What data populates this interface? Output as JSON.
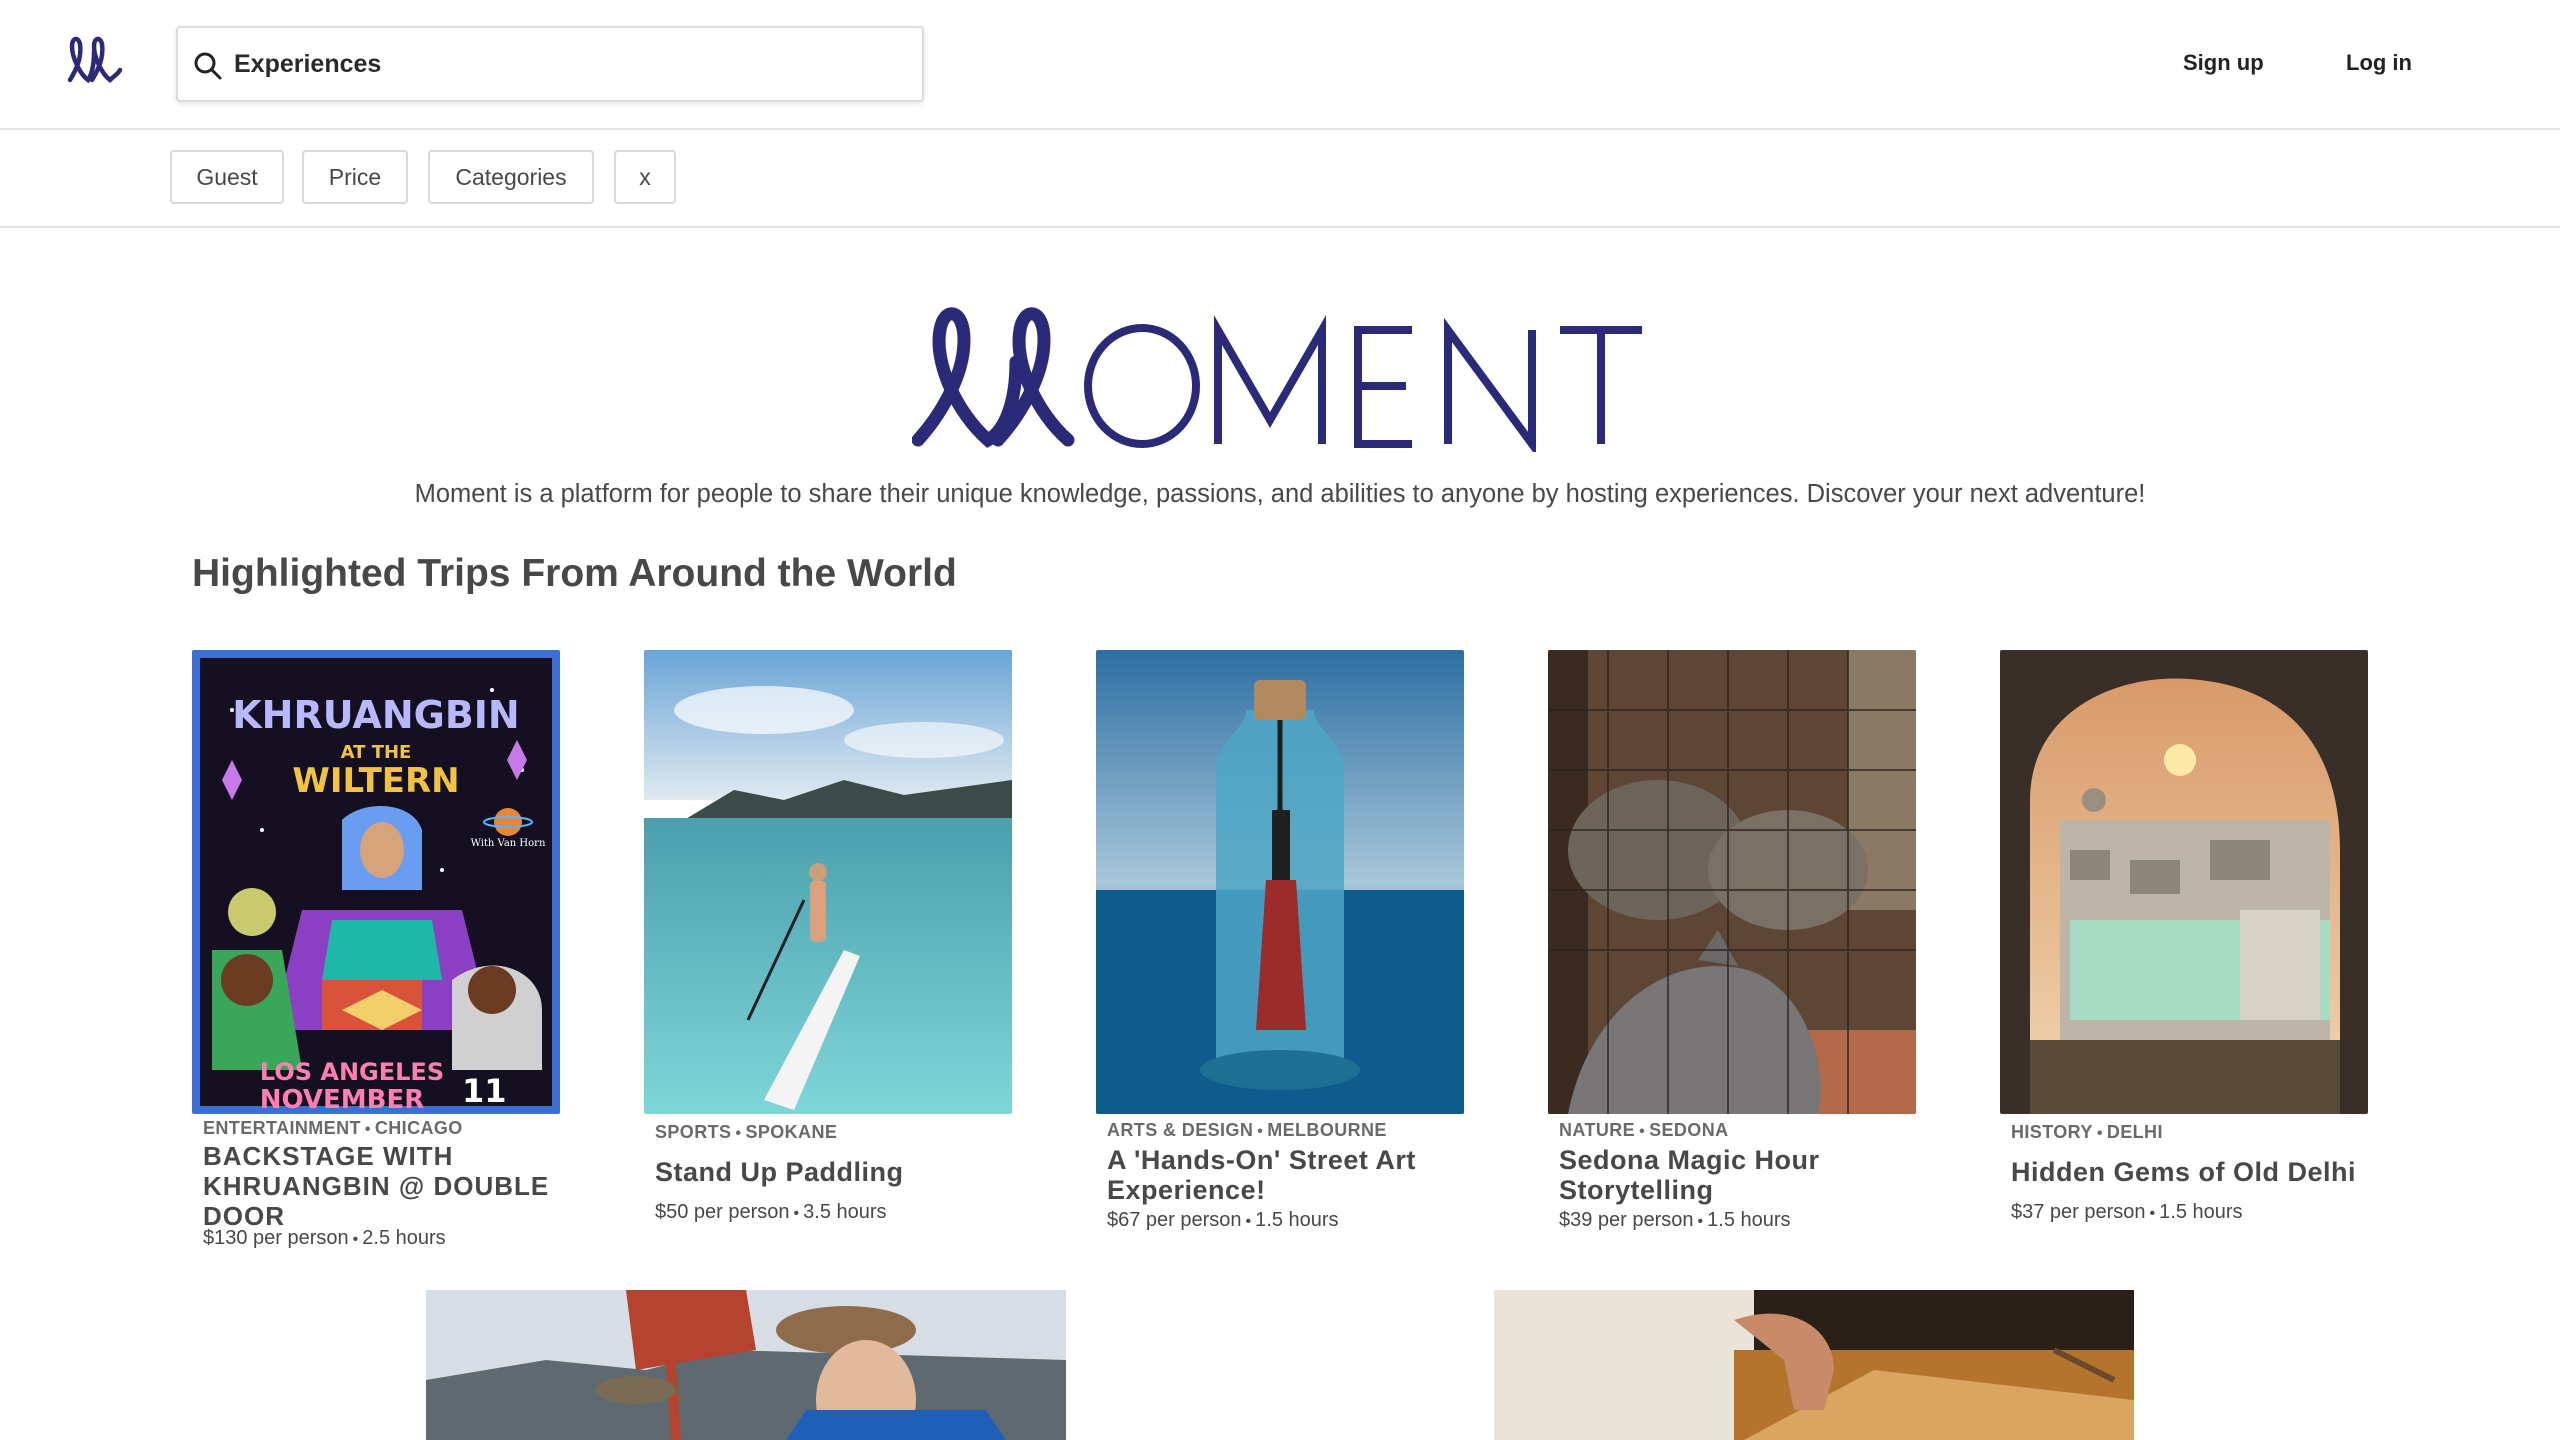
{
  "header": {
    "search_value": "Experiences",
    "signup_label": "Sign up",
    "login_label": "Log in"
  },
  "filters": [
    {
      "label": "Guest"
    },
    {
      "label": "Price"
    },
    {
      "label": "Categories"
    },
    {
      "label": "x"
    }
  ],
  "hero": {
    "brand": "MOMENT",
    "tagline": "Moment is a platform for people to share their unique knowledge, passions, and abilities to anyone by hosting experiences. Discover your next adventure!"
  },
  "section_title": "Highlighted Trips From Around the World",
  "cards": [
    {
      "category": "ENTERTAINMENT",
      "city": "CHICAGO",
      "title": "BACKSTAGE WITH KHRUANGBIN @ DOUBLE DOOR",
      "price": "$130 per person",
      "duration": "2.5 hours"
    },
    {
      "category": "SPORTS",
      "city": "SPOKANE",
      "title": "Stand Up Paddling",
      "price": "$50 per person",
      "duration": "3.5 hours"
    },
    {
      "category": "ARTS & DESIGN",
      "city": "MELBOURNE",
      "title": "A 'Hands-On' Street Art Experience!",
      "price": "$67 per person",
      "duration": "1.5 hours"
    },
    {
      "category": "NATURE",
      "city": "SEDONA",
      "title": "Sedona Magic Hour Storytelling",
      "price": "$39 per person",
      "duration": "1.5 hours"
    },
    {
      "category": "HISTORY",
      "city": "DELHI",
      "title": "Hidden Gems of Old Delhi",
      "price": "$37 per person",
      "duration": "1.5 hours"
    }
  ],
  "poster": {
    "line1": "KHRUANGBIN",
    "line2": "AT THE",
    "line3": "WILTERN",
    "line4": "LOS ANGELES",
    "line5": "NOVEMBER",
    "date": "11",
    "guest": "With Van Horn"
  },
  "colors": {
    "brand": "#2b2a78",
    "text": "#484848",
    "meta": "#6a6a6a",
    "border": "#e4e4e4"
  }
}
